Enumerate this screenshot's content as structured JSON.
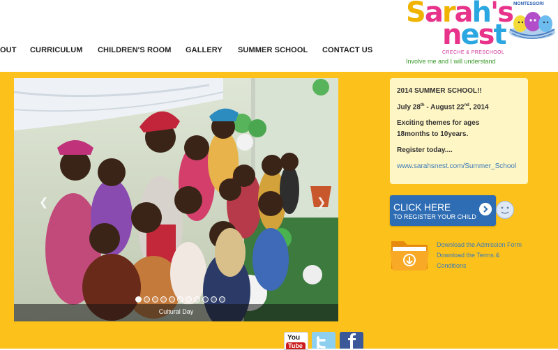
{
  "nav": {
    "items": [
      {
        "label": "OUT"
      },
      {
        "label": "CURRICULUM"
      },
      {
        "label": "CHILDREN'S ROOM"
      },
      {
        "label": "GALLERY"
      },
      {
        "label": "SUMMER SCHOOL"
      },
      {
        "label": "CONTACT US"
      }
    ]
  },
  "logo": {
    "line1": "Sarah's",
    "line2": "nest",
    "subtitle": "CRECHE & PRESCHOOL",
    "montessori": "MONTESSORI",
    "tagline": "Involve me and I will understand"
  },
  "slider": {
    "caption": "Cultural Day",
    "dot_count": 11,
    "active_dot": 0,
    "prev_icon": "chevron-left-icon",
    "next_icon": "chevron-right-icon"
  },
  "summer_box": {
    "title": "2014 SUMMER SCHOOL!!",
    "date_start": "July 28",
    "date_start_sup": "th",
    "date_mid": " - August 22",
    "date_end_sup": "nd",
    "date_year": ", 2014",
    "themes_line1": "Exciting themes for ages",
    "themes_line2": "18months to 10years.",
    "register": "Register today....",
    "link": "www.sarahsnest.com/Summer_School"
  },
  "register_button": {
    "top": "CLICK HERE",
    "bottom": "TO REGISTER YOUR CHILD"
  },
  "downloads": {
    "admission": "Download the Admission Form",
    "terms_line1": "Download the Terms &",
    "terms_line2": "Conditions"
  },
  "social": {
    "youtube_top": "You",
    "youtube_bottom": "Tube"
  },
  "colors": {
    "background_yellow": "#fcc21b",
    "nav_text": "#222222",
    "link_blue": "#3a7ab8",
    "button_blue": "#2e6db4",
    "info_box": "#fff6c5"
  }
}
